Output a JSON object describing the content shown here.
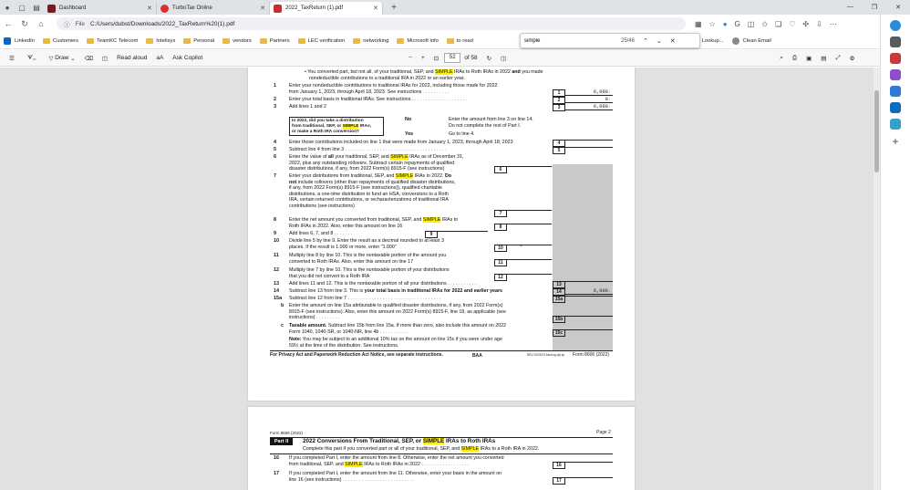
{
  "tabs": [
    {
      "title": "Dashboard",
      "color": "#7b1c1c"
    },
    {
      "title": "TurboTax Online",
      "color": "#d8302e"
    },
    {
      "title": "2022_TaxReturn (1).pdf",
      "color": "#c4302b"
    }
  ],
  "address": {
    "label": "File",
    "url": "C:/Users/dubst/Downloads/2022_TaxReturn%20(1).pdf"
  },
  "bookmarks": [
    "LinkedIn",
    "Customers",
    "TeamKC Telecom",
    "Intelisys",
    "Personal",
    "vendors",
    "Partners",
    "LEC verification",
    "networking",
    "Microsoft info",
    "to read"
  ],
  "bookmarks_right": [
    "ZIP Code™ Lookup...",
    "Clean Email"
  ],
  "find": {
    "query": "simple",
    "count": "25/46"
  },
  "pdf_toolbar": {
    "draw": "Draw",
    "read_aloud": "Read aloud",
    "aa": "aA",
    "copilot": "Ask Copilot",
    "page": "52",
    "of": "of 58"
  },
  "page1": {
    "intro": [
      "• You converted part, but not all, of your traditional, SEP, and ",
      "SIMPLE",
      " IRAs to Roth IRAs in 2022 ",
      "and",
      " you made",
      "nondeductible contributions to a traditional IRA in 2022 or an earlier year."
    ],
    "lines": [
      {
        "n": "1",
        "t": "Enter your nondeductible contributions to traditional IRAs for 2022, including those made for 2022",
        "t2": "from January 1, 2023, through April 18, 2023. See instructions",
        "box": "1",
        "amt": "6,000."
      },
      {
        "n": "2",
        "t": "Enter your total basis in traditional IRAs. See instructions",
        "box": "2",
        "amt": "0."
      },
      {
        "n": "3",
        "t": "Add lines 1 and 2",
        "box": "3",
        "amt": "6,000."
      },
      {
        "n": "4",
        "t": "Enter those contributions included on line 1 that were made from January 1, 2023, through April 18, 2023",
        "box": "4",
        "amt": ""
      },
      {
        "n": "5",
        "t": "Subtract line 4 from line 3",
        "box": "5",
        "amt": ""
      }
    ],
    "question": [
      "In 2022, did you take a distribution",
      "from traditional, SEP, or SIMPLE IRAs,",
      "or make a Roth IRA conversion?"
    ],
    "no_label": "No",
    "yes_label": "Yes",
    "no_text": [
      "Enter the amount from line 3 on line 14.",
      "Do not complete the rest of Part I."
    ],
    "yes_text": "Go to line 4.",
    "l6": [
      "Enter the value of ",
      "all",
      " your traditional, SEP, and ",
      "SIMPLE",
      " IRAs as of December 31,",
      "2022, plus any outstanding rollovers. Subtract certain repayments of qualified",
      "disaster distributions, if any, from 2022 Form(s) 8915-F (see instructions)"
    ],
    "l7": [
      "Enter your distributions from traditional, SEP, and ",
      "SIMPLE",
      " IRAs in 2022. ",
      "Do",
      "not",
      " include rollovers (other than repayments of qualified disaster distributions,",
      "if any, from 2022 Form(s) 8915-F (see instructions)), qualified charitable",
      "distributions, a one-time distribution to fund an HSA, conversions to a Roth",
      "IRA, certain returned contributions, or recharacterizations of traditional IRA",
      "contributions (see instructions)"
    ],
    "l8": [
      "Enter the net amount you converted from traditional, SEP, and ",
      "SIMPLE",
      " IRAs to",
      "Roth IRAs in 2022. Also, enter this amount on line 16"
    ],
    "l9": "Add lines 6, 7, and 8",
    "l10": [
      "Divide line 5 by line 9. Enter the result as a decimal rounded to at least 3",
      "places. If the result is 1.000 or more, enter \"1.000\""
    ],
    "l11": [
      "Multiply line 8 by line 10. This is the nontaxable portion of the amount you",
      "converted to Roth IRAs. Also, enter this amount on line 17"
    ],
    "l12": [
      "Multiply line 7 by line 10. This is the nontaxable portion of your distributions",
      "that you did not convert to a Roth IRA"
    ],
    "l13": "Add lines 11 and 12. This is the nontaxable portion of all your distributions",
    "l14": [
      "Subtract line 13 from line 3. This is ",
      "your total basis in traditional IRAs for 2022 and earlier years"
    ],
    "l14amt": "6,000.",
    "l15a": "Subtract line 12 from line 7",
    "l15b": [
      "Enter the amount on line 15a attributable to qualified disaster distributions, if any, from 2022 Form(s)",
      "8915-F (see instructions). Also, enter this amount on 2022 Form(s) 8915-F, line 18, as applicable (see",
      "instructions)"
    ],
    "l15c": [
      "Taxable amount.",
      " Subtract line 15b from line 15a. If more than zero, also include this amount on 2022",
      "Form 1040, 1040-SR, or 1040-NR, line 4b"
    ],
    "note": [
      "Note:",
      " You may be subject to an additional 10% tax on the amount on line 15c if you were under age",
      "59½ at the time of the distribution. See instructions."
    ],
    "footer_left": "For Privacy Act and Paperwork Reduction Act Notice, see separate instructions.",
    "footer_mid": "BAA",
    "footer_code": "REV 02/22/23 Intuit.cg.cfp.sp",
    "footer_form": "Form 8606 (2022)"
  },
  "page2": {
    "form_label": "Form 8606 (2022)",
    "page_label": "Page 2",
    "part": "Part II",
    "title": [
      "2022 Conversions From Traditional, SEP, or ",
      "SIMPLE",
      " IRAs to Roth IRAs"
    ],
    "subtitle": [
      "Complete this part if you converted part or all of your traditional, SEP, and ",
      "SIMPLE",
      " IRAs to a Roth IRA in 2022."
    ],
    "l16": [
      "If you completed Part I, enter the amount from line 8. Otherwise, enter the net amount you converted",
      "from traditional, SEP, and ",
      "SIMPLE",
      " IRAs to Roth IRAs in 2022"
    ],
    "l17": [
      "If you completed Part I, enter the amount from line 11. Otherwise, enter your basis in the amount on",
      "line 16 (see instructions)"
    ]
  }
}
